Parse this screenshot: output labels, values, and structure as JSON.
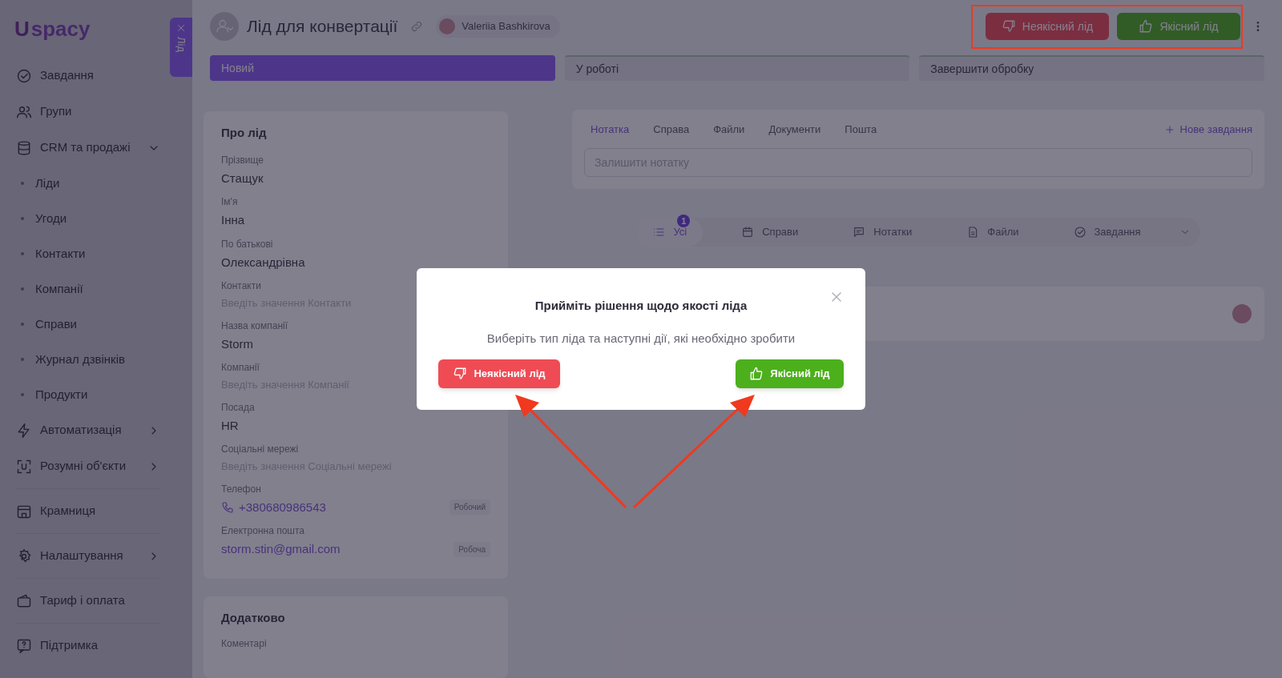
{
  "sidebar": {
    "logo_mark": "U",
    "logo_text": "spacy",
    "lead_tab": "Лід",
    "items": [
      {
        "label": "Завдання",
        "kind": "link"
      },
      {
        "label": "Групи",
        "kind": "link"
      },
      {
        "label": "CRM та продажі",
        "kind": "group",
        "expanded": true,
        "children": [
          {
            "label": "Ліди"
          },
          {
            "label": "Угоди"
          },
          {
            "label": "Контакти"
          },
          {
            "label": "Компанії"
          },
          {
            "label": "Справи"
          },
          {
            "label": "Журнал дзвінків"
          },
          {
            "label": "Продукти"
          }
        ]
      },
      {
        "label": "Автоматизація",
        "kind": "group",
        "expanded": false
      },
      {
        "label": "Розумні об'єкти",
        "kind": "group",
        "expanded": false
      },
      {
        "label": "Крамниця",
        "kind": "link"
      },
      {
        "label": "Налаштування",
        "kind": "group",
        "expanded": false
      },
      {
        "label": "Тариф і оплата",
        "kind": "link"
      },
      {
        "label": "Підтримка",
        "kind": "link"
      }
    ]
  },
  "header": {
    "title": "Лід для конвертації",
    "owner": "Valeriia Bashkirova",
    "actions": [
      {
        "label": "Неякісний лід",
        "kind": "bad"
      },
      {
        "label": "Якісний лід",
        "kind": "good"
      }
    ]
  },
  "stages": [
    {
      "label": "Новий",
      "selected": true
    },
    {
      "label": "У роботі",
      "selected": false
    },
    {
      "label": "Завершити обробку",
      "selected": false
    }
  ],
  "about": {
    "title": "Про лід",
    "fields": [
      {
        "label": "Прізвище",
        "value": "Стащук",
        "kind": "text"
      },
      {
        "label": "Ім'я",
        "value": "Інна",
        "kind": "text"
      },
      {
        "label": "По батькові",
        "value": "Олександрівна",
        "kind": "text"
      },
      {
        "label": "Контакти",
        "placeholder": "Введіть значення Контакти",
        "kind": "empty"
      },
      {
        "label": "Назва компанії",
        "value": "Storm",
        "kind": "text"
      },
      {
        "label": "Компанії",
        "placeholder": "Введіть значення Компанії",
        "kind": "empty"
      },
      {
        "label": "Посада",
        "value": "HR",
        "kind": "text"
      },
      {
        "label": "Соціальні мережі",
        "placeholder": "Введіть значення Соціальні мережі",
        "kind": "empty"
      },
      {
        "label": "Телефон",
        "value": "+380680986543",
        "kind": "phone",
        "tag": "Робочий"
      },
      {
        "label": "Електронна пошта",
        "value": "storm.stin@gmail.com",
        "kind": "email",
        "tag": "Робоча"
      }
    ]
  },
  "extra": {
    "title": "Додатково",
    "fields": [
      {
        "label": "Коментарі"
      }
    ]
  },
  "composer": {
    "tabs": [
      {
        "label": "Нотатка",
        "selected": true
      },
      {
        "label": "Справа",
        "selected": false
      },
      {
        "label": "Файли",
        "selected": false
      },
      {
        "label": "Документи",
        "selected": false
      },
      {
        "label": "Пошта",
        "selected": false
      }
    ],
    "new_task": "Нове завдання",
    "placeholder": "Залишити нотатку"
  },
  "filters": [
    {
      "label": "Усі",
      "selected": true,
      "badge": "1"
    },
    {
      "label": "Справи",
      "selected": false
    },
    {
      "label": "Нотатки",
      "selected": false
    },
    {
      "label": "Файли",
      "selected": false
    },
    {
      "label": "Завдання",
      "selected": false
    }
  ],
  "dialog": {
    "title": "Прийміть рішення щодо якості ліда",
    "message": "Виберіть тип ліда та наступні дії, які необхідно зробити",
    "buttons": [
      {
        "label": "Неякісний лід",
        "kind": "bad"
      },
      {
        "label": "Якісний лід",
        "kind": "good"
      }
    ]
  }
}
